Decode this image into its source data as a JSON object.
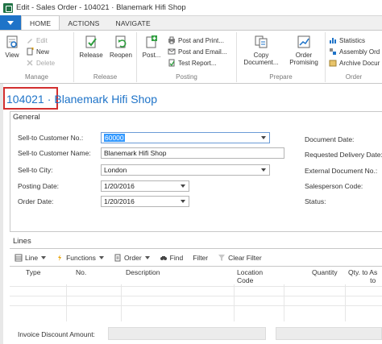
{
  "window": {
    "title": "Edit - Sales Order - 104021 · Blanemark Hifi Shop"
  },
  "ribbon": {
    "tabs": [
      "HOME",
      "ACTIONS",
      "NAVIGATE"
    ],
    "groups": {
      "manage": {
        "label": "Manage",
        "view": "View",
        "edit": "Edit",
        "new": "New",
        "delete": "Delete"
      },
      "release": {
        "label": "Release",
        "release": "Release",
        "reopen": "Reopen"
      },
      "posting": {
        "label": "Posting",
        "post": "Post...",
        "post_and_print": "Post and Print...",
        "post_and_email": "Post and Email...",
        "test_report": "Test Report..."
      },
      "prepare": {
        "label": "Prepare",
        "copy_document": [
          "Copy",
          "Document..."
        ],
        "order_promising": [
          "Order",
          "Promising"
        ]
      },
      "order": {
        "label": "Order",
        "statistics": "Statistics",
        "assembly_orders": "Assembly Ord",
        "archive_document": "Archive Docur"
      }
    }
  },
  "page": {
    "number": "104021",
    "separator": "·",
    "customer": "Blanemark Hifi Shop"
  },
  "general": {
    "header": "General",
    "fields": {
      "sell_to_customer_no": {
        "label": "Sell-to Customer No.:",
        "value": "60000"
      },
      "sell_to_customer_name": {
        "label": "Sell-to Customer Name:",
        "value": "Blanemark Hifi Shop"
      },
      "sell_to_city": {
        "label": "Sell-to City:",
        "value": "London"
      },
      "posting_date": {
        "label": "Posting Date:",
        "value": "1/20/2016"
      },
      "order_date": {
        "label": "Order Date:",
        "value": "1/20/2016"
      },
      "document_date": {
        "label": "Document Date:"
      },
      "requested_delivery_date": {
        "label": "Requested Delivery Date:"
      },
      "external_document_no": {
        "label": "External Document No.:"
      },
      "salesperson_code": {
        "label": "Salesperson Code:"
      },
      "status": {
        "label": "Status:"
      }
    }
  },
  "lines": {
    "header": "Lines",
    "toolbar": {
      "line": "Line",
      "functions": "Functions",
      "order": "Order",
      "find": "Find",
      "filter": "Filter",
      "clear_filter": "Clear Filter"
    },
    "columns": {
      "type": "Type",
      "no": "No.",
      "description": "Description",
      "location": "Location",
      "code": "Code",
      "quantity": "Quantity",
      "qty_to_assemble": "Qty. to As",
      "qty_to_assemble_2": "to"
    }
  },
  "footer": {
    "invoice_discount_label": "Invoice Discount Amount:"
  },
  "colors": {
    "accent": "#1e73c8",
    "highlight": "#d32f2f",
    "selection": "#3399ff"
  },
  "icons": [
    "app-icon",
    "dropdown-icon",
    "view-icon",
    "edit-icon",
    "new-icon",
    "delete-icon",
    "release-icon",
    "reopen-icon",
    "post-icon",
    "post-print-icon",
    "post-email-icon",
    "test-report-icon",
    "copy-document-icon",
    "order-promising-icon",
    "statistics-icon",
    "assembly-icon",
    "archive-icon",
    "line-icon",
    "functions-icon",
    "order-icon",
    "find-icon",
    "clear-filter-icon"
  ]
}
